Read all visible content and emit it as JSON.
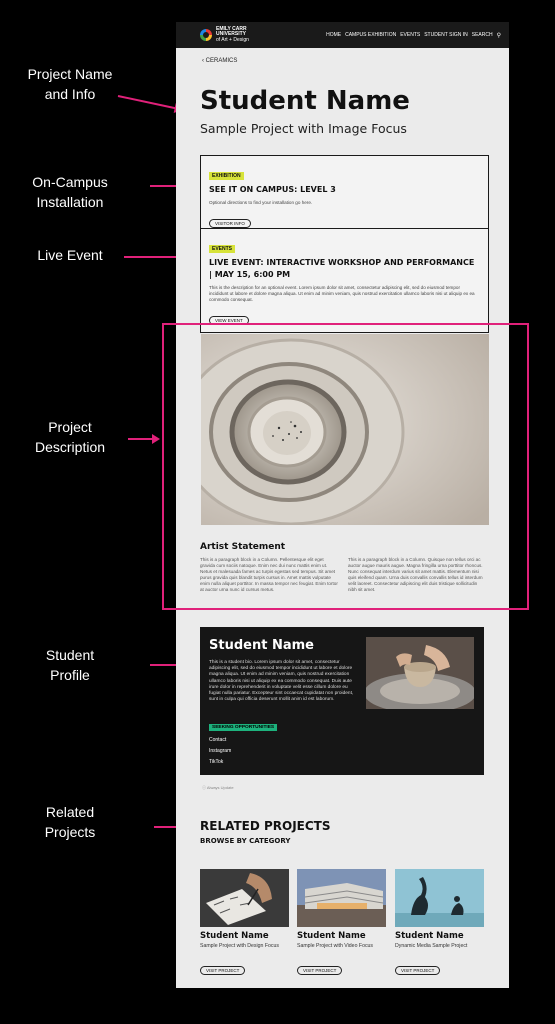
{
  "annotations": {
    "project_name": [
      "Project Name",
      "and Info"
    ],
    "on_campus": [
      "On-Campus",
      "Installation"
    ],
    "live_event": [
      "Live Event"
    ],
    "project_description": [
      "Project",
      "Description"
    ],
    "student_profile": [
      "Student",
      "Profile"
    ],
    "related_projects": [
      "Related",
      "Projects"
    ]
  },
  "header": {
    "logo_line1": "EMILY CARR",
    "logo_line2": "UNIVERSITY",
    "logo_line3": "of Art + Design",
    "nav": [
      "HOME",
      "CAMPUS EXHIBITION",
      "EVENTS",
      "STUDENT SIGN IN",
      "SEARCH"
    ],
    "search_icon": "search-icon"
  },
  "breadcrumb": "CERAMICS",
  "project": {
    "title": "Student Name",
    "subtitle": "Sample Project with Image Focus"
  },
  "exhibition": {
    "tag": "EXHIBITION",
    "heading": "SEE IT ON CAMPUS: LEVEL 3",
    "text": "Optional directions to find your installation go here.",
    "button": "VISITOR INFO"
  },
  "event": {
    "tag": "EVENTS",
    "heading": "LIVE EVENT: INTERACTIVE WORKSHOP AND PERFORMANCE | MAY 15, 6:00 PM",
    "text": "This is the description for an optional event. Lorem ipsum dolor sit amet, consectetur adipiscing elit, sed do eiusmod tempor incididunt ut labore et dolore magna aliqua. Ut enim ad minim veniam, quis nostrud exercitation ullamco laboris nisi ut aliquip ex ea commodo consequat.",
    "button": "VIEW EVENT"
  },
  "statement": {
    "heading": "Artist Statement",
    "col1": "This is a paragraph block in a Column. Pellentesque elit eget gravida cum sociis natoque. Enim nec dui nunc mattis enim ut. Netus et malesuada fames ac turpis egestas sed tempus. Sit amet purus gravida quis blandit turpis cursus in. Amet mattis vulputate enim nulla aliquet porttitor. In massa tempor nec feugiat. Enim tortor at auctor urna nunc id cursus metus.",
    "col2": "This is a paragraph block in a Column. Quisque non tellus orci ac auctor augue mauris augue. Magna fringilla urna porttitor rhoncus. Nunc consequat interdum varius sit amet mattis. Elementum nisi quis eleifend quam. Urna duis convallis convallis tellus id interdum velit laoreet. Consectetur adipiscing elit duis tristique sollicitudin nibh sit amet."
  },
  "profile": {
    "name": "Student Name",
    "bio": "This is a student bio. Lorem ipsum dolor sit amet, consectetur adipiscing elit, sed do eiusmod tempor incididunt ut labore et dolore magna aliqua. Ut enim ad minim veniam, quis nostrud exercitation ullamco laboris nisi ut aliquip ex ea commodo consequat. Duis aute irure dolor in reprehenderit in voluptate velit esse cillum dolore eu fugiat nulla pariatur. Excepteur sint occaecat cupidatat non proident, sunt in culpa qui officia deserunt mollit anim id est laborum.",
    "badge": "SEEKING OPPORTUNITIES",
    "links": [
      "Contact",
      "Instagram",
      "TikTok"
    ]
  },
  "note": "Always Update",
  "related": {
    "heading": "RELATED PROJECTS",
    "sub": "BROWSE BY CATEGORY",
    "items": [
      {
        "name": "Student Name",
        "desc": "Sample Project with Design Focus",
        "button": "VISIT PROJECT"
      },
      {
        "name": "Student Name",
        "desc": "Sample Project with Video Focus",
        "button": "VISIT PROJECT"
      },
      {
        "name": "Student Name",
        "desc": "Dynamic Media Sample Project",
        "button": "VISIT PROJECT"
      }
    ]
  },
  "colors": {
    "accent": "#e0217a",
    "exhibition_tag": "#d7e33a",
    "seeking": "#1db27d"
  }
}
